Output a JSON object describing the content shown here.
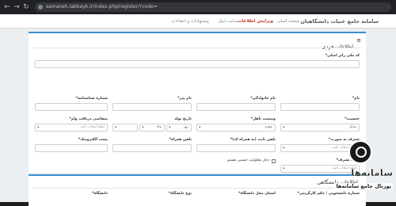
{
  "browser": {
    "url": "samaneh.labbayk.ir/index.php/register/?code="
  },
  "topnav": {
    "brand": "سامانه جامع عتبات دانشگاهیان",
    "links": [
      "صفحه اصلی",
      "ویرایش اطلاعات",
      "سایت لبیک",
      "پیشنهادات و انتقادات"
    ]
  },
  "section1": {
    "title": "اطلاعات فردی",
    "fields": {
      "national_code": {
        "label": "کد ملی زائر اصلی*",
        "value": ""
      },
      "first_name": {
        "label": "نام*",
        "value": ""
      },
      "last_name": {
        "label": "نام خانوادگی*",
        "value": ""
      },
      "father_name": {
        "label": "نام پدر*",
        "value": ""
      },
      "id_number": {
        "label": "شماره شناسنامه*",
        "value": ""
      },
      "gender": {
        "label": "جنسیت*",
        "value": "مذکر"
      },
      "marital": {
        "label": "وضعیت تأهل*",
        "value": "مجرد"
      },
      "birth_date": {
        "label": "تاریخ تولد",
        "day": "روز",
        "month": "ماه",
        "year": ""
      },
      "passport_place": {
        "label": "متقاضی دریافت وام*",
        "value": "لطفا انتخاب کنید"
      },
      "mobile_type": {
        "label": "تشرف به صورت*",
        "value": "لطفا انتخاب کنید"
      },
      "companion_code": {
        "label": "تلفن ثابت (به همراه کد)*",
        "value": ""
      },
      "mobile": {
        "label": "تلفن همراه*",
        "value": ""
      },
      "email": {
        "label": "پست الکترونیک*",
        "value": ""
      },
      "visit_count": {
        "label": "تعداد تشرف*",
        "value": "لطفا انتخاب کنید"
      },
      "disability": {
        "label": "دچار معلولیت جسمی هستم"
      }
    }
  },
  "section2": {
    "title": "اطلاعات دانشگاهی",
    "labels": [
      "شماره دانشجویی / حکم کارگزینی*",
      "استان محل دانشگاه*",
      "نوع دانشگاه*",
      "دانشگاه*"
    ]
  },
  "watermark": {
    "name": "سامانه‌ها",
    "subtitle": "پورتال جامع سامانه‌ها"
  }
}
